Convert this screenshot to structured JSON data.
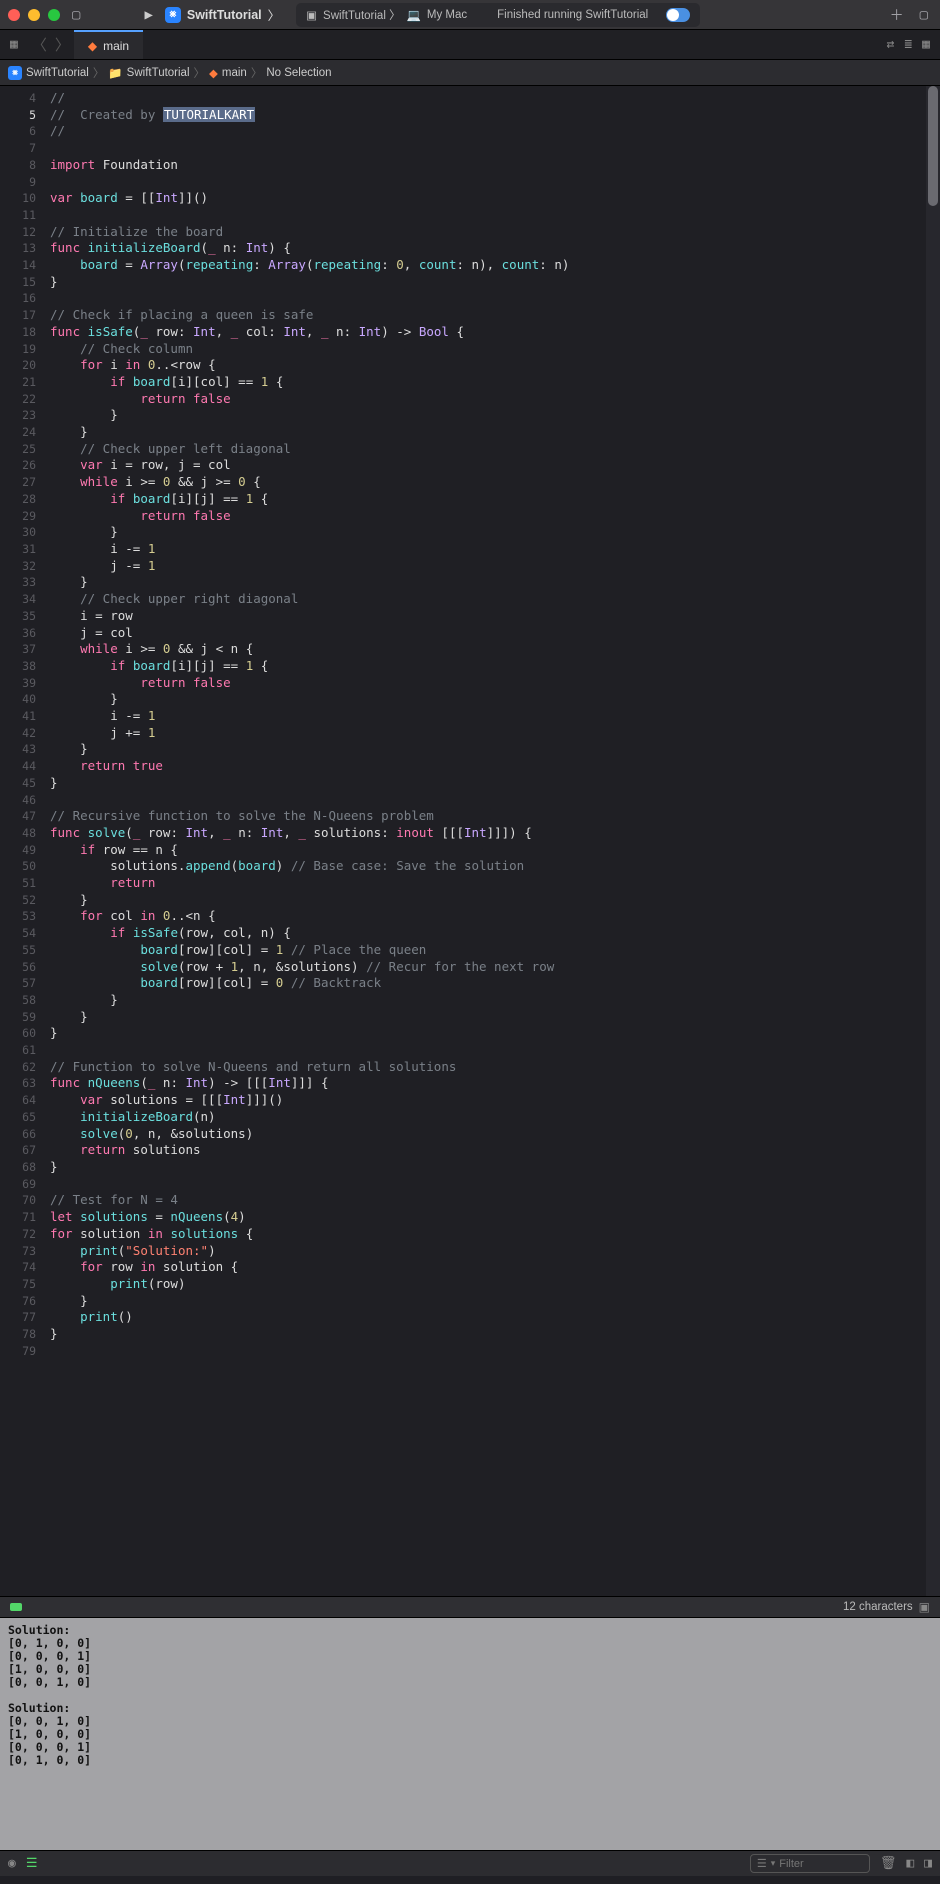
{
  "titlebar": {
    "scheme_project": "SwiftTutorial",
    "scheme_sep": " 〉",
    "status_prefix": "SwiftTutorial 〉",
    "status_device": "My Mac",
    "status_msg": "Finished running SwiftTutorial"
  },
  "tab": {
    "name": "main"
  },
  "jumpbar": {
    "p1": "SwiftTutorial",
    "p2": "SwiftTutorial",
    "p3": "main",
    "p4": "No Selection"
  },
  "gutter": {
    "start": 4,
    "end": 79,
    "highlight": 5
  },
  "code_lines": [
    "<span class='cm'>//</span>",
    "<span class='cm'>//  Created by </span><span class='sel'>TUTORIALKART</span>",
    "<span class='cm'>//</span>",
    "",
    "<span class='kw'>import</span> <span class='pa'>Foundation</span>",
    "",
    "<span class='kw'>var</span> <span class='id'>board</span> = [[<span class='ty'>Int</span>]]()",
    "",
    "<span class='cm'>// Initialize the board</span>",
    "<span class='kw'>func</span> <span class='fn'>initializeBoard</span>(<span class='kw'>_</span> n: <span class='ty'>Int</span>) {",
    "    <span class='id'>board</span> = <span class='ty'>Array</span>(<span class='id'>repeating</span>: <span class='ty'>Array</span>(<span class='id'>repeating</span>: <span class='nu'>0</span>, <span class='id'>count</span>: n), <span class='id'>count</span>: n)",
    "}",
    "",
    "<span class='cm'>// Check if placing a queen is safe</span>",
    "<span class='kw'>func</span> <span class='fn'>isSafe</span>(<span class='kw'>_</span> row: <span class='ty'>Int</span>, <span class='kw'>_</span> col: <span class='ty'>Int</span>, <span class='kw'>_</span> n: <span class='ty'>Int</span>) -> <span class='ty'>Bool</span> {",
    "    <span class='cm'>// Check column</span>",
    "    <span class='kw'>for</span> i <span class='kw'>in</span> <span class='nu'>0</span>..&lt;row {",
    "        <span class='kw'>if</span> <span class='id'>board</span>[i][col] == <span class='nu'>1</span> {",
    "            <span class='kw'>return</span> <span class='kw'>false</span>",
    "        }",
    "    }",
    "    <span class='cm'>// Check upper left diagonal</span>",
    "    <span class='kw'>var</span> i = row, j = col",
    "    <span class='kw'>while</span> i &gt;= <span class='nu'>0</span> &amp;&amp; j &gt;= <span class='nu'>0</span> {",
    "        <span class='kw'>if</span> <span class='id'>board</span>[i][j] == <span class='nu'>1</span> {",
    "            <span class='kw'>return</span> <span class='kw'>false</span>",
    "        }",
    "        i -= <span class='nu'>1</span>",
    "        j -= <span class='nu'>1</span>",
    "    }",
    "    <span class='cm'>// Check upper right diagonal</span>",
    "    i = row",
    "    j = col",
    "    <span class='kw'>while</span> i &gt;= <span class='nu'>0</span> &amp;&amp; j &lt; n {",
    "        <span class='kw'>if</span> <span class='id'>board</span>[i][j] == <span class='nu'>1</span> {",
    "            <span class='kw'>return</span> <span class='kw'>false</span>",
    "        }",
    "        i -= <span class='nu'>1</span>",
    "        j += <span class='nu'>1</span>",
    "    }",
    "    <span class='kw'>return</span> <span class='kw'>true</span>",
    "}",
    "",
    "<span class='cm'>// Recursive function to solve the N-Queens problem</span>",
    "<span class='kw'>func</span> <span class='fn'>solve</span>(<span class='kw'>_</span> row: <span class='ty'>Int</span>, <span class='kw'>_</span> n: <span class='ty'>Int</span>, <span class='kw'>_</span> solutions: <span class='kw'>inout</span> [[[<span class='ty'>Int</span>]]]) {",
    "    <span class='kw'>if</span> row == n {",
    "        solutions.<span class='id'>append</span>(<span class='id'>board</span>) <span class='cm'>// Base case: Save the solution</span>",
    "        <span class='kw'>return</span>",
    "    }",
    "    <span class='kw'>for</span> col <span class='kw'>in</span> <span class='nu'>0</span>..&lt;n {",
    "        <span class='kw'>if</span> <span class='fn'>isSafe</span>(row, col, n) {",
    "            <span class='id'>board</span>[row][col] = <span class='nu'>1</span> <span class='cm'>// Place the queen</span>",
    "            <span class='fn'>solve</span>(row + <span class='nu'>1</span>, n, &amp;solutions) <span class='cm'>// Recur for the next row</span>",
    "            <span class='id'>board</span>[row][col] = <span class='nu'>0</span> <span class='cm'>// Backtrack</span>",
    "        }",
    "    }",
    "}",
    "",
    "<span class='cm'>// Function to solve N-Queens and return all solutions</span>",
    "<span class='kw'>func</span> <span class='fn'>nQueens</span>(<span class='kw'>_</span> n: <span class='ty'>Int</span>) -> [[[<span class='ty'>Int</span>]]] {",
    "    <span class='kw'>var</span> solutions = [[[<span class='ty'>Int</span>]]]()",
    "    <span class='fn'>initializeBoard</span>(n)",
    "    <span class='fn'>solve</span>(<span class='nu'>0</span>, n, &amp;solutions)",
    "    <span class='kw'>return</span> solutions",
    "}",
    "",
    "<span class='cm'>// Test for N = 4</span>",
    "<span class='kw'>let</span> <span class='id'>solutions</span> = <span class='fn'>nQueens</span>(<span class='nu'>4</span>)",
    "<span class='kw'>for</span> solution <span class='kw'>in</span> <span class='id'>solutions</span> {",
    "    <span class='fn'>print</span>(<span class='st'>\"Solution:\"</span>)",
    "    <span class='kw'>for</span> row <span class='kw'>in</span> solution {",
    "        <span class='fn'>print</span>(row)",
    "    }",
    "    <span class='fn'>print</span>()",
    "}",
    ""
  ],
  "debug": {
    "chars": "12 characters"
  },
  "console": "Solution:\n[0, 1, 0, 0]\n[0, 0, 0, 1]\n[1, 0, 0, 0]\n[0, 0, 1, 0]\n\nSolution:\n[0, 0, 1, 0]\n[1, 0, 0, 0]\n[0, 0, 0, 1]\n[0, 1, 0, 0]\n",
  "filter": {
    "placeholder": "Filter"
  }
}
